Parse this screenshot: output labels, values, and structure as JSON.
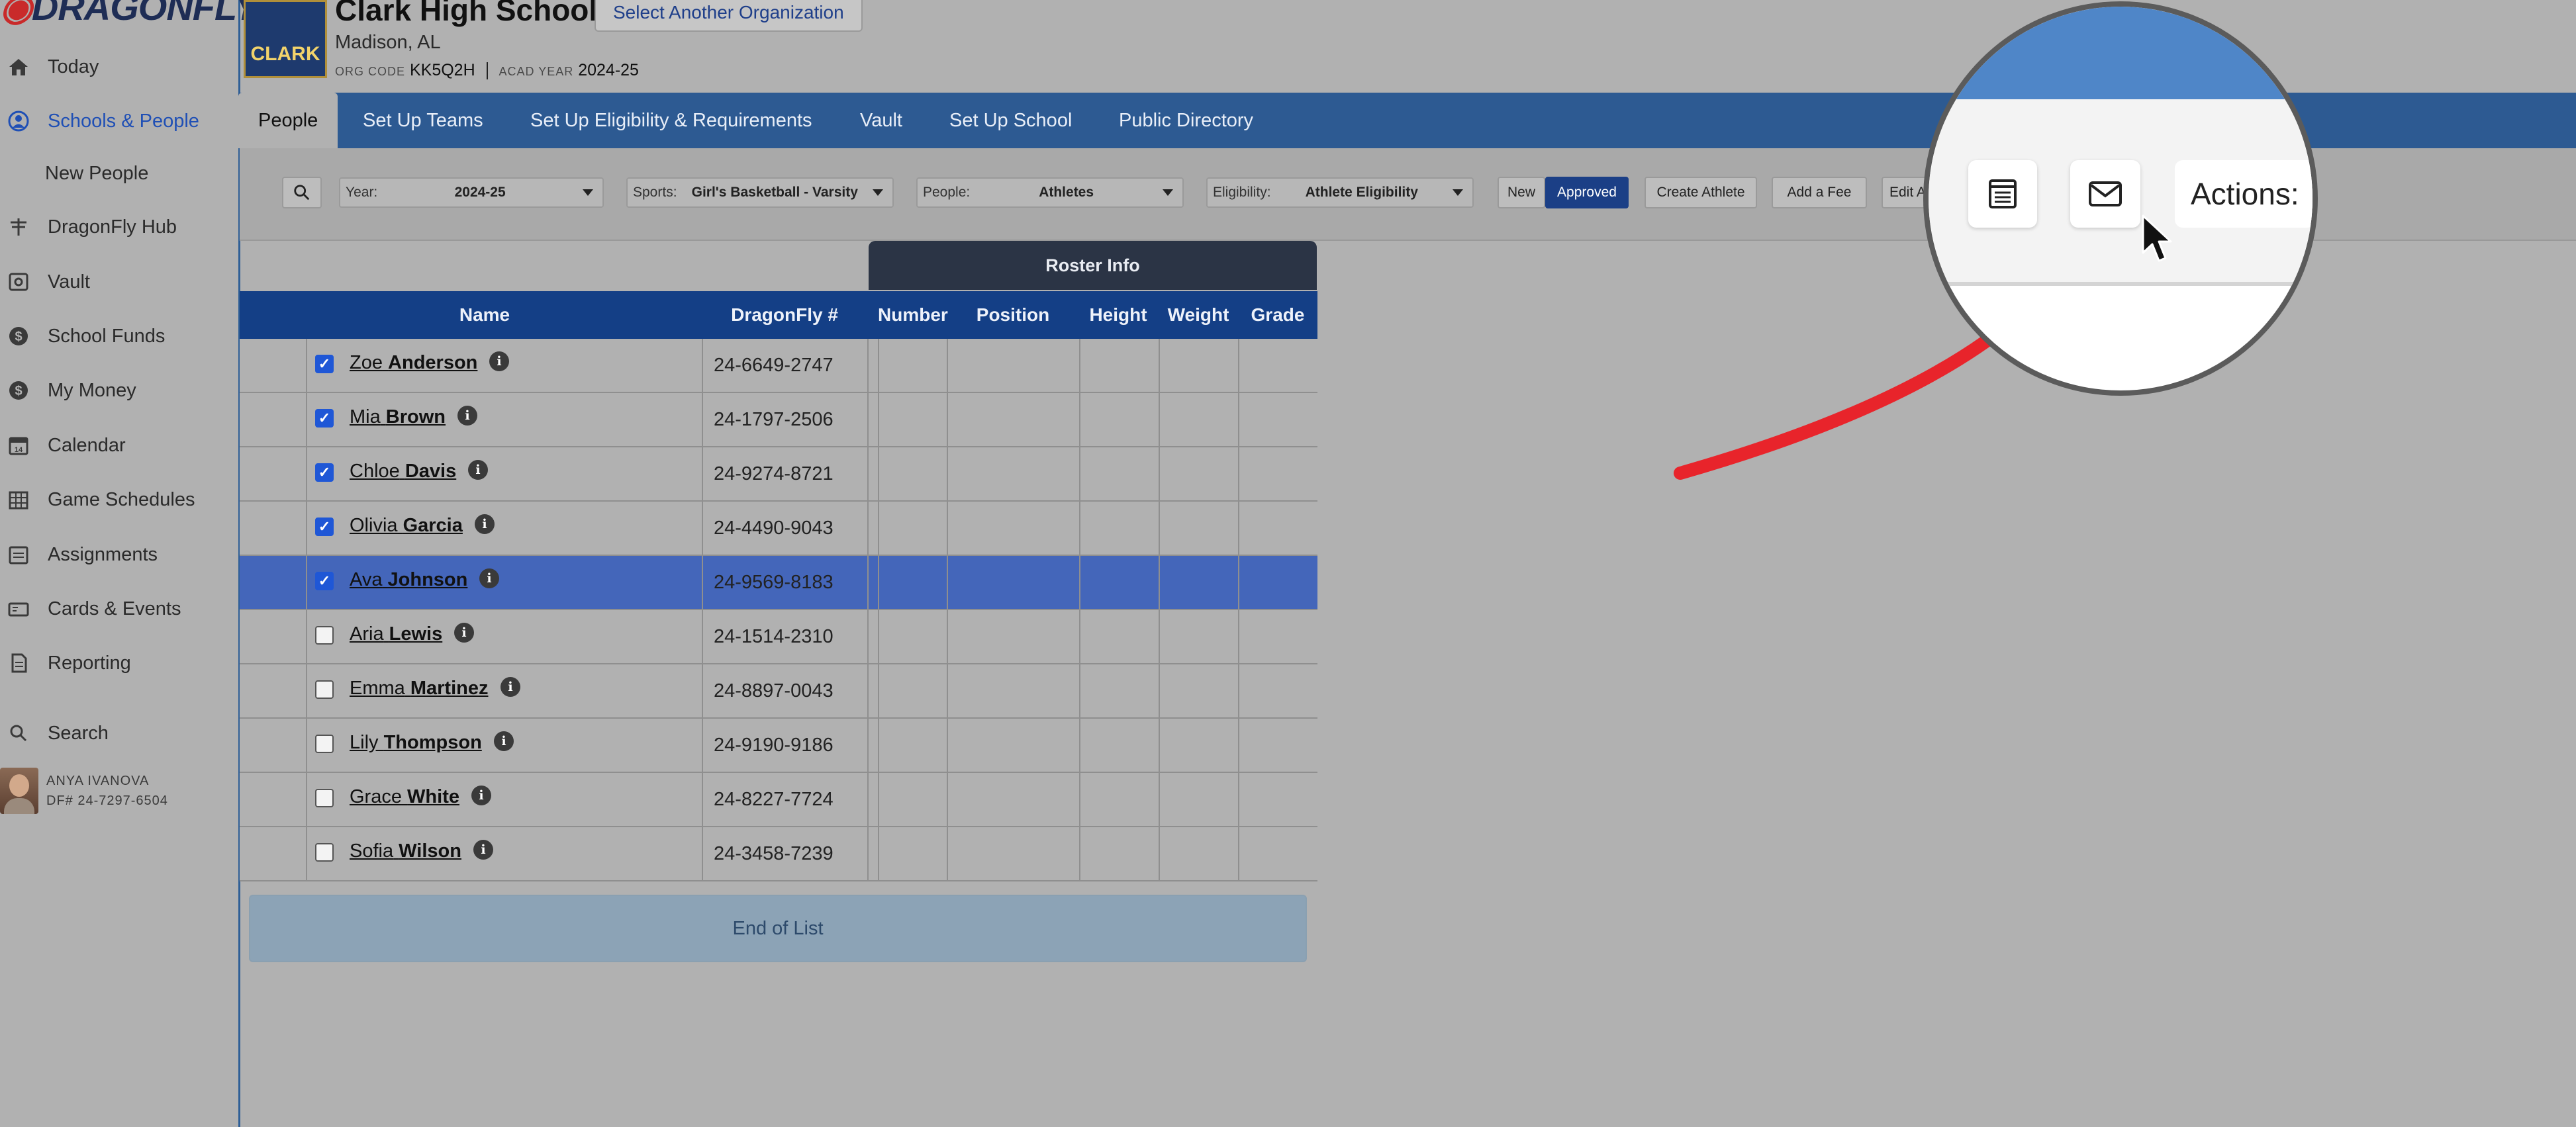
{
  "brand": {
    "logo_text": "DRAGONFLY"
  },
  "sidebar": {
    "items": [
      {
        "label": "Today",
        "icon": "home-icon"
      },
      {
        "label": "Schools & People",
        "icon": "person-circle-icon",
        "active": true
      },
      {
        "label": "New People",
        "sub": true
      },
      {
        "label": "DragonFly Hub",
        "icon": "dragonfly-icon"
      },
      {
        "label": "Vault",
        "icon": "vault-icon"
      },
      {
        "label": "School Funds",
        "icon": "dollar-coin-icon"
      },
      {
        "label": "My Money",
        "icon": "dollar-coin-icon"
      },
      {
        "label": "Calendar",
        "icon": "calendar-icon"
      },
      {
        "label": "Game Schedules",
        "icon": "schedule-grid-icon"
      },
      {
        "label": "Assignments",
        "icon": "assignments-icon"
      },
      {
        "label": "Cards & Events",
        "icon": "card-icon"
      },
      {
        "label": "Reporting",
        "icon": "document-icon"
      },
      {
        "label": "Search",
        "icon": "search-icon"
      }
    ],
    "user": {
      "name": "ANYA IVANOVA",
      "df_number": "DF# 24-7297-6504"
    }
  },
  "header": {
    "school_name": "Clark High School",
    "crest_text": "CLARK",
    "select_org_label": "Select Another Organization",
    "city": "Madison, AL",
    "org_code_label": "ORG CODE",
    "org_code": "KK5Q2H",
    "acad_year_label": "ACAD YEAR",
    "acad_year": "2024-25"
  },
  "tabs": [
    "People",
    "Set Up Teams",
    "Set Up Eligibility & Requirements",
    "Vault",
    "Set Up School",
    "Public Directory"
  ],
  "filters": {
    "year": {
      "label": "Year:",
      "value": "2024-25"
    },
    "sports": {
      "label": "Sports:",
      "value": "Girl's Basketball - Varsity"
    },
    "people": {
      "label": "People:",
      "value": "Athletes"
    },
    "eligibility": {
      "label": "Eligibility:",
      "value": "Athlete Eligibility"
    },
    "toggle": [
      "New",
      "Approved"
    ],
    "toggle_selected": "Approved",
    "buttons": [
      "Create Athlete",
      "Add a Fee",
      "Edit A"
    ]
  },
  "table": {
    "group_header": "Roster Info",
    "columns": [
      "Name",
      "DragonFly #",
      "Number",
      "Position",
      "Height",
      "Weight",
      "Grade"
    ],
    "rows": [
      {
        "first": "Zoe",
        "last": "Anderson",
        "df": "24-6649-2747",
        "checked": true
      },
      {
        "first": "Mia",
        "last": "Brown",
        "df": "24-1797-2506",
        "checked": true
      },
      {
        "first": "Chloe",
        "last": "Davis",
        "df": "24-9274-8721",
        "checked": true
      },
      {
        "first": "Olivia",
        "last": "Garcia",
        "df": "24-4490-9043",
        "checked": true
      },
      {
        "first": "Ava",
        "last": "Johnson",
        "df": "24-9569-8183",
        "checked": true,
        "highlighted": true
      },
      {
        "first": "Aria",
        "last": "Lewis",
        "df": "24-1514-2310",
        "checked": false
      },
      {
        "first": "Emma",
        "last": "Martinez",
        "df": "24-8897-0043",
        "checked": false
      },
      {
        "first": "Lily",
        "last": "Thompson",
        "df": "24-9190-9186",
        "checked": false
      },
      {
        "first": "Grace",
        "last": "White",
        "df": "24-8227-7724",
        "checked": false
      },
      {
        "first": "Sofia",
        "last": "Wilson",
        "df": "24-3458-7239",
        "checked": false
      }
    ],
    "end_label": "End of List"
  },
  "magnifier": {
    "actions_label": "Actions:",
    "icons": [
      "list-icon",
      "mail-icon"
    ]
  },
  "colors": {
    "tab_bar": "#2d5a92",
    "table_header": "#143f86",
    "highlight_row": "#4466ba",
    "arrow": "#e8242b",
    "active_nav": "#1f4fb5"
  }
}
